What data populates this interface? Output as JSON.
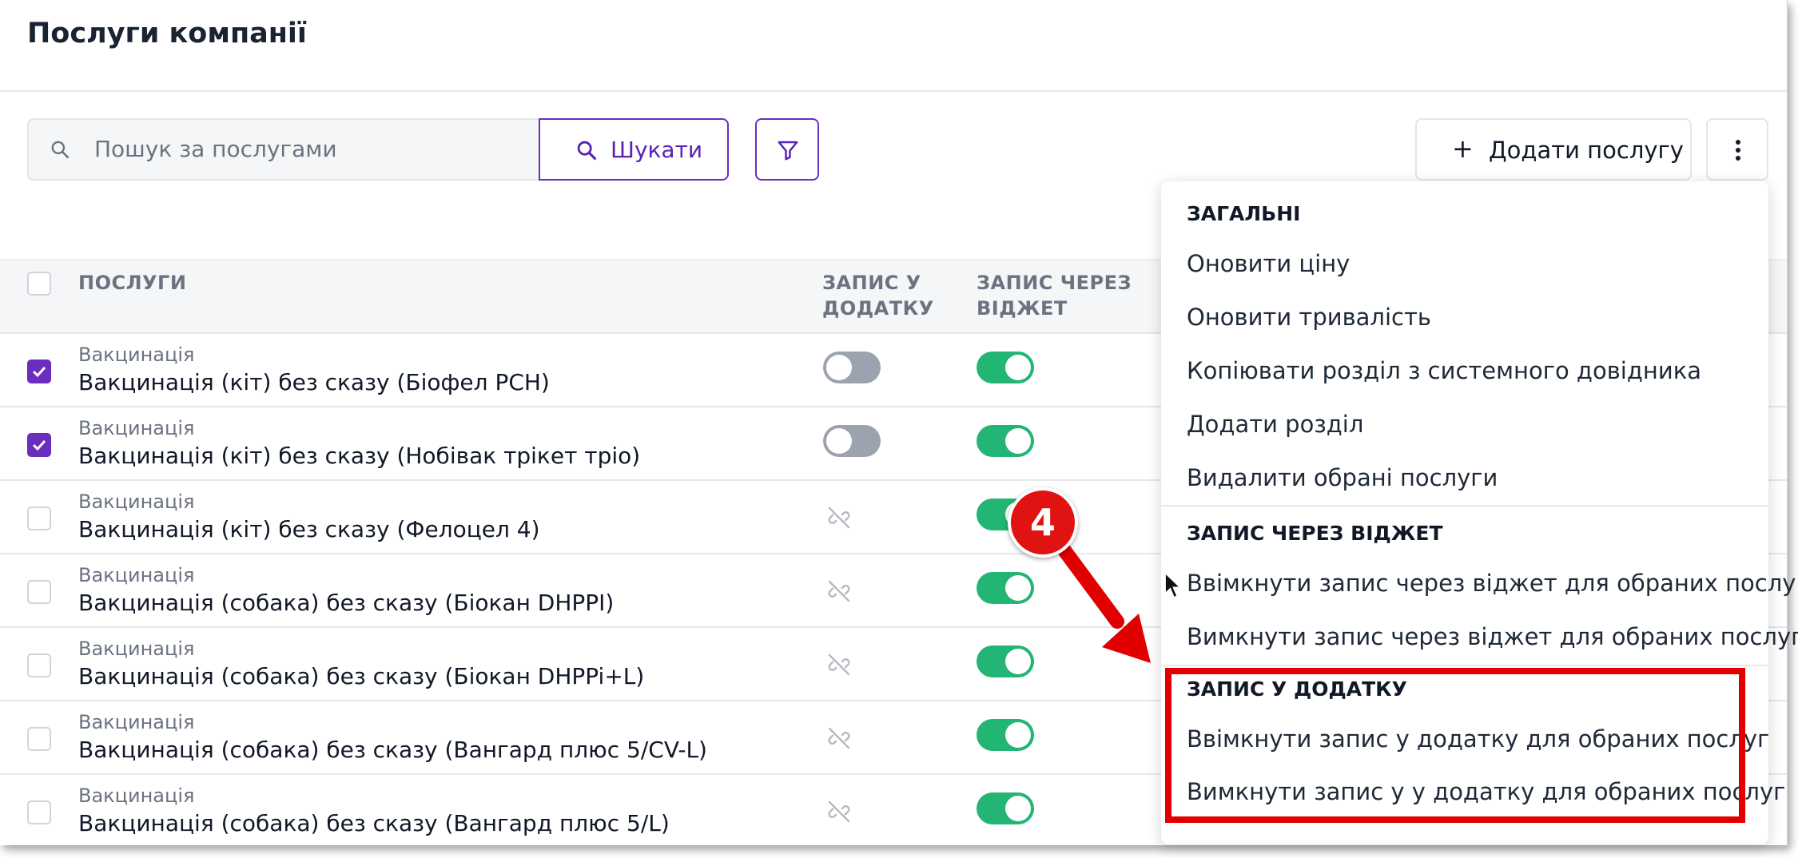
{
  "page": {
    "title": "Послуги компанії"
  },
  "toolbar": {
    "search_placeholder": "Пошук за послугами",
    "search_button": "Шукати",
    "add_button": "Додати послугу"
  },
  "table": {
    "columns": [
      "ПОСЛУГИ",
      "ЗАПИС У ДОДАТКУ",
      "ЗАПИС ЧЕРЕЗ ВІДЖЕТ"
    ],
    "rows": [
      {
        "category": "Вакцинація",
        "name": "Вакцинація (кіт) без сказу (Біофел PCH)",
        "checked": true,
        "app": "off",
        "widget": "on"
      },
      {
        "category": "Вакцинація",
        "name": "Вакцинація (кіт) без сказу (Нобівак трікет тріо)",
        "checked": true,
        "app": "off",
        "widget": "on"
      },
      {
        "category": "Вакцинація",
        "name": "Вакцинація (кіт) без сказу (Фелоцел 4)",
        "checked": false,
        "app": "unlinked",
        "widget": "on"
      },
      {
        "category": "Вакцинація",
        "name": "Вакцинація (собака) без сказу (Біокан DHPPI)",
        "checked": false,
        "app": "unlinked",
        "widget": "on"
      },
      {
        "category": "Вакцинація",
        "name": "Вакцинація (собака) без сказу (Біокан DHPPi+L)",
        "checked": false,
        "app": "unlinked",
        "widget": "on"
      },
      {
        "category": "Вакцинація",
        "name": "Вакцинація (собака) без сказу (Вангард плюс 5/CV-L)",
        "checked": false,
        "app": "unlinked",
        "widget": "on"
      },
      {
        "category": "Вакцинація",
        "name": "Вакцинація (собака) без сказу (Вангард плюс 5/L)",
        "checked": false,
        "app": "unlinked",
        "widget": "on"
      }
    ]
  },
  "menu": {
    "general_header": "ЗАГАЛЬНІ",
    "update_price": "Оновити ціну",
    "update_duration": "Оновити тривалість",
    "copy_section": "Копіювати розділ з системного довідника",
    "add_section": "Додати розділ",
    "delete_selected": "Видалити обрані послуги",
    "widget_header": "ЗАПИС ЧЕРЕЗ ВІДЖЕТ",
    "widget_enable": "Ввімкнути запис через віджет для обраних послуг",
    "widget_disable": "Вимкнути запис через віджет для обраних послуг",
    "app_header": "ЗАПИС У ДОДАТКУ",
    "app_enable": "Ввімкнути запис у додатку для обраних послуг",
    "app_disable": "Вимкнути запис у у додатку для обраних послуг"
  },
  "annotation": {
    "step": "4",
    "color": "#e00000"
  },
  "colors": {
    "accent": "#6b2dbe",
    "toggle_on": "#22b573",
    "toggle_off": "#9ca3af"
  },
  "icons": [
    "search-icon",
    "filter-icon",
    "plus-icon",
    "more-vertical-icon",
    "unlink-icon",
    "check-icon",
    "cursor-icon"
  ]
}
